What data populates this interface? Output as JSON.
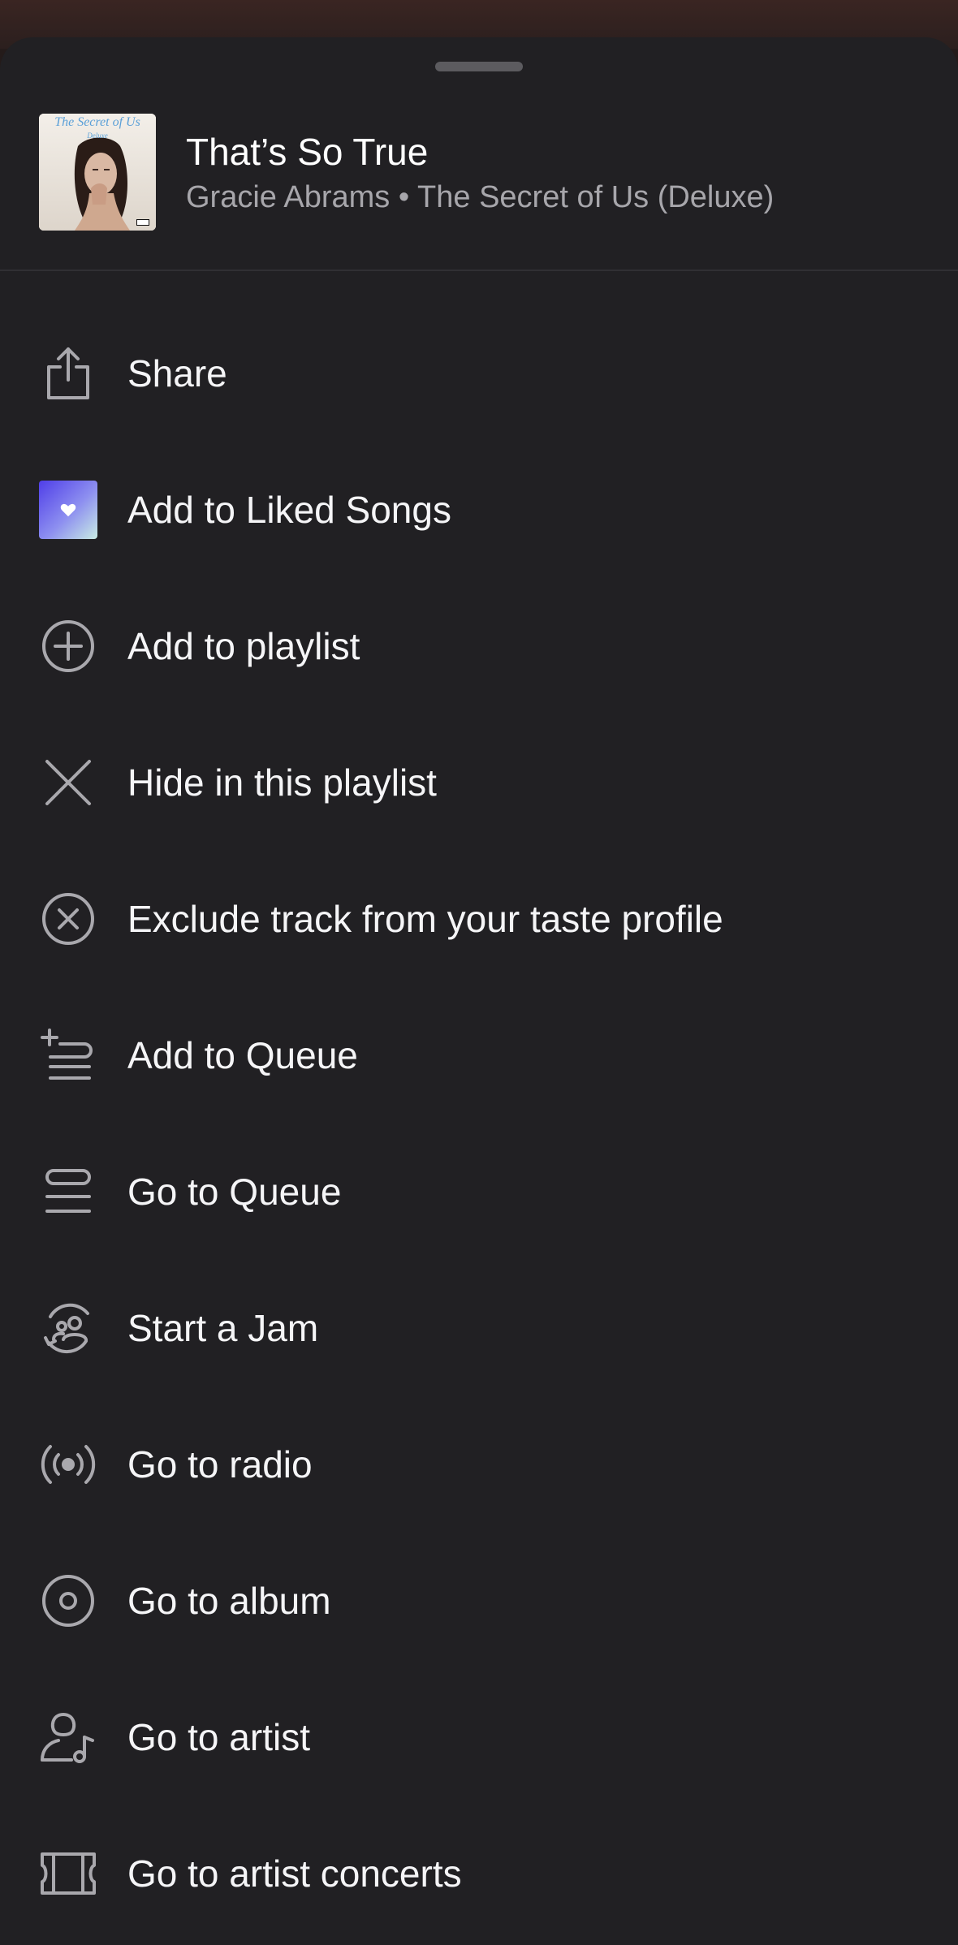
{
  "track": {
    "title": "That’s So True",
    "subtitle": "Gracie Abrams • The Secret of Us (Deluxe)",
    "cover_title": "The Secret of Us",
    "cover_subtitle": "Deluxe"
  },
  "menu": {
    "items": [
      {
        "label": "Share",
        "icon": "share-icon"
      },
      {
        "label": "Add to Liked Songs",
        "icon": "liked-songs-icon"
      },
      {
        "label": "Add to playlist",
        "icon": "plus-circle-icon"
      },
      {
        "label": "Hide in this playlist",
        "icon": "close-icon"
      },
      {
        "label": "Exclude track from your taste profile",
        "icon": "exclude-circle-icon"
      },
      {
        "label": "Add to Queue",
        "icon": "add-to-queue-icon"
      },
      {
        "label": "Go to Queue",
        "icon": "queue-icon"
      },
      {
        "label": "Start a Jam",
        "icon": "jam-icon"
      },
      {
        "label": "Go to radio",
        "icon": "radio-icon"
      },
      {
        "label": "Go to album",
        "icon": "album-icon"
      },
      {
        "label": "Go to artist",
        "icon": "artist-icon"
      },
      {
        "label": "Go to artist concerts",
        "icon": "ticket-icon"
      }
    ]
  },
  "colors": {
    "sheet_bg": "#212023",
    "text_primary": "#ffffff",
    "text_secondary": "#a7a6ab",
    "icon": "#a9a8ad",
    "liked_gradient_start": "#4f3ee8",
    "liked_gradient_end": "#c9ece4"
  }
}
